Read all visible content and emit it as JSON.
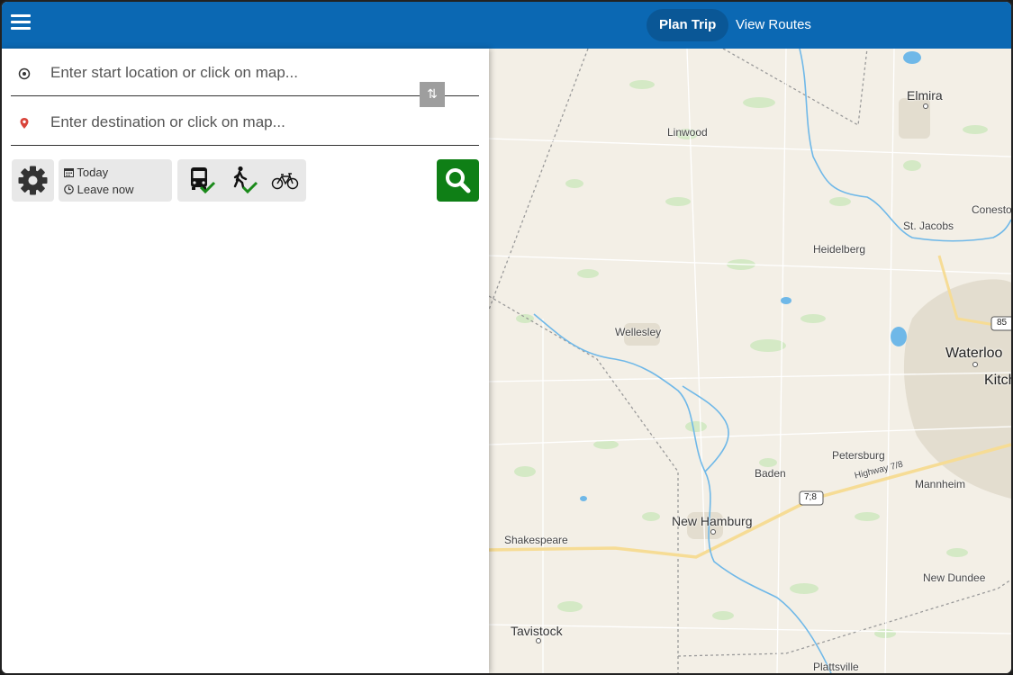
{
  "header": {
    "tabs": [
      {
        "label": "Plan Trip",
        "active": true
      },
      {
        "label": "View Routes",
        "active": false
      }
    ]
  },
  "trip_form": {
    "start_placeholder": "Enter start location or click on map...",
    "destination_placeholder": "Enter destination or click on map...",
    "when": {
      "day": "Today",
      "time": "Leave now"
    },
    "modes": [
      {
        "name": "bus",
        "selected": true
      },
      {
        "name": "walk",
        "selected": true
      },
      {
        "name": "bike",
        "selected": false
      }
    ]
  },
  "map": {
    "places": {
      "elmira": "Elmira",
      "linwood": "Linwood",
      "conestogo": "Conesto",
      "st_jacobs": "St. Jacobs",
      "heidelberg": "Heidelberg",
      "wellesley": "Wellesley",
      "waterloo": "Waterloo",
      "kitchener": "Kitch",
      "petersburg": "Petersburg",
      "baden": "Baden",
      "mannheim": "Mannheim",
      "new_hamburg": "New Hamburg",
      "shakespeare": "Shakespeare",
      "new_dundee": "New Dundee",
      "tavistock": "Tavistock",
      "plattsville": "Plattsville"
    },
    "road_labels": {
      "highway": "Highway 7/8",
      "shield_7_8": "7;8",
      "shield_85": "85"
    }
  },
  "colors": {
    "header_bg": "#0b68b3",
    "active_tab_bg": "#0a5796",
    "search_button": "#0f7f16",
    "check_mark": "#1a8a1a",
    "destination_pin": "#d9443a",
    "map_land": "#f3efe6",
    "map_water": "#6fb8e8",
    "map_green": "#cfe6bf"
  }
}
